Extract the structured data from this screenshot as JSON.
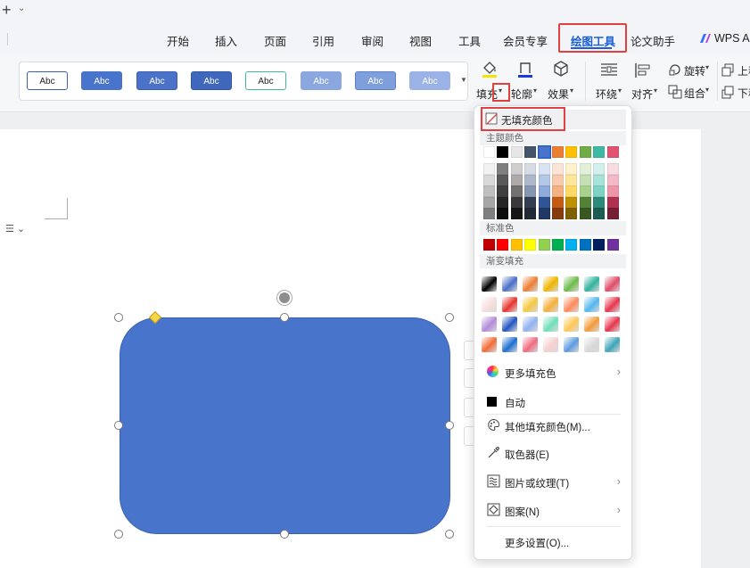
{
  "titlebar": {
    "plus_glyph": "+",
    "chevron_glyph": "⌄"
  },
  "menu": {
    "items": [
      "开始",
      "插入",
      "页面",
      "引用",
      "审阅",
      "视图",
      "工具",
      "会员专享",
      "绘图工具",
      "论文助手",
      "WPS AI"
    ],
    "active": "绘图工具"
  },
  "ribbon": {
    "style_gallery": {
      "swatch_label": "Abc",
      "swatches": [
        {
          "fill": "#ffffff",
          "border": "#3c5fa8",
          "text": "#222222"
        },
        {
          "fill": "#4874cb",
          "border": "#4874cb",
          "text": "#ffffff"
        },
        {
          "fill": "#4a72c8",
          "border": "#3a5fb0",
          "text": "#ffffff"
        },
        {
          "fill": "#3f68bd",
          "border": "#2f57a8",
          "text": "#ffffff"
        },
        {
          "fill": "#ffffff",
          "border": "#3fb9a4",
          "text": "#222222"
        },
        {
          "fill": "#8aa7e0",
          "border": "#8aa7e0",
          "text": "#ffffff"
        },
        {
          "fill": "#7f9fdc",
          "border": "#5b7fc8",
          "text": "#ffffff"
        },
        {
          "fill": "#9bb2e6",
          "border": "#9bb2e6",
          "text": "#ffffff"
        }
      ]
    },
    "fill_label": "填充",
    "outline_label": "轮廓",
    "effects_label": "效果",
    "wrap_label": "环绕",
    "align_label": "对齐",
    "rotate_label": "旋转",
    "group_label": "组合",
    "bring_up_label": "上移",
    "send_down_label": "下移"
  },
  "fill_menu": {
    "no_fill": "无填充颜色",
    "theme_colors_header": "主题颜色",
    "theme_top_row": [
      "#ffffff",
      "#000000",
      "#e7e6e6",
      "#44546a",
      "#4874cb",
      "#ed7d31",
      "#ffc000",
      "#70ad47",
      "#3fb9a4",
      "#e15371"
    ],
    "theme_shades": [
      [
        "#f2f2f2",
        "#7f7f7f",
        "#d0cece",
        "#d6dce4",
        "#dae3f3",
        "#fbe5d6",
        "#fff2cc",
        "#e2f0d9",
        "#d4f0ec",
        "#f9dce3"
      ],
      [
        "#d9d9d9",
        "#595959",
        "#aeaaaa",
        "#adb9ca",
        "#b4c7e7",
        "#f8cbad",
        "#ffe699",
        "#c5e0b4",
        "#a9e2d9",
        "#f3b9c6"
      ],
      [
        "#bfbfbf",
        "#3f3f3f",
        "#757070",
        "#8496b0",
        "#8faadc",
        "#f4b183",
        "#ffd966",
        "#a9d18e",
        "#7ed3c6",
        "#ed96aa"
      ],
      [
        "#a6a6a6",
        "#262626",
        "#3a3838",
        "#333f50",
        "#2f5597",
        "#c55a11",
        "#bf9000",
        "#548235",
        "#2c8a7b",
        "#b03052"
      ],
      [
        "#7f7f7f",
        "#0d0d0d",
        "#171616",
        "#222a35",
        "#203864",
        "#843c0c",
        "#7f6000",
        "#385723",
        "#1d5c52",
        "#751f37"
      ]
    ],
    "standard_header": "标准色",
    "standard_colors": [
      "#c00000",
      "#ff0000",
      "#ffc000",
      "#ffff00",
      "#92d050",
      "#00b050",
      "#00b0f0",
      "#0070c0",
      "#002060",
      "#7030a0"
    ],
    "gradient_header": "渐变填充",
    "gradients": [
      [
        "#000000",
        "#4a6fc9",
        "#ed7d31",
        "#f0b400",
        "#6dbb49",
        "#2fb39e",
        "#e04a66"
      ],
      [
        "#f7dede",
        "#e8352f",
        "#f5c842",
        "#f5b13d",
        "#ff8a5c",
        "#53b7ef",
        "#e8354d"
      ],
      [
        "#b38bd9",
        "#2356c2",
        "#8fb2f0",
        "#6fe0b9",
        "#ffc857",
        "#f49b3b",
        "#e8354d"
      ],
      [
        "#f26b38",
        "#1d6fd1",
        "#f16a7f",
        "#f5d0d0",
        "#5f9be0",
        "#d8d8d8",
        "#3fa4b8"
      ]
    ],
    "more_fill_colors": "更多填充色",
    "auto": "自动",
    "other_fill_colors": "其他填充颜色(M)...",
    "eyedropper": "取色器(E)",
    "picture_texture": "图片或纹理(T)",
    "pattern": "图案(N)",
    "more_settings": "更多设置(O)...",
    "chevron_right": "›"
  },
  "shape": {
    "fill": "#4874cb"
  }
}
